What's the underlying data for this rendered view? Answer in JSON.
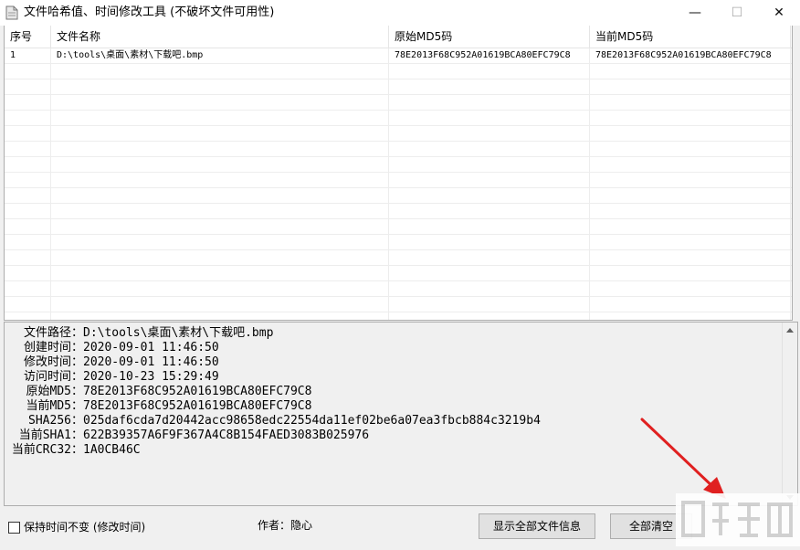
{
  "window": {
    "title": "文件哈希值、时间修改工具 (不破坏文件可用性)",
    "minimize_glyph": "—",
    "maximize_glyph": "☐",
    "close_glyph": "✕"
  },
  "table": {
    "columns": [
      "序号",
      "文件名称",
      "原始MD5码",
      "当前MD5码"
    ],
    "rows": [
      [
        "1",
        "D:\\tools\\桌面\\素材\\下载吧.bmp",
        "78E2013F68C952A01619BCA80EFC79C8",
        "78E2013F68C952A01619BCA80EFC79C8"
      ]
    ]
  },
  "info": {
    "lines": [
      {
        "label": "文件路径：",
        "value": "D:\\tools\\桌面\\素材\\下载吧.bmp"
      },
      {
        "label": "创建时间：",
        "value": "2020-09-01 11:46:50"
      },
      {
        "label": "修改时间：",
        "value": "2020-09-01 11:46:50"
      },
      {
        "label": "访问时间：",
        "value": "2020-10-23 15:29:49"
      },
      {
        "label": "原始MD5：",
        "value": "78E2013F68C952A01619BCA80EFC79C8"
      },
      {
        "label": "当前MD5：",
        "value": "78E2013F68C952A01619BCA80EFC79C8"
      },
      {
        "label": "SHA256：",
        "value": "025daf6cda7d20442acc98658edc22554da11ef02be6a07ea3fbcb884c3219b4"
      },
      {
        "label": "当前SHA1：",
        "value": "622B39357A6F9F367A4C8B154FAED3083B025976"
      },
      {
        "label": "当前CRC32：",
        "value": "1A0CB46C"
      }
    ]
  },
  "controls": {
    "keep_time_label": "保持时间不变 (修改时间)",
    "keep_time_checked": false,
    "author": "作者：隐心",
    "show_all_button": "显示全部文件信息",
    "clear_all_button": "全部清空"
  },
  "colors": {
    "arrow": "#e02020",
    "window_bg": "#f0f0f0"
  }
}
